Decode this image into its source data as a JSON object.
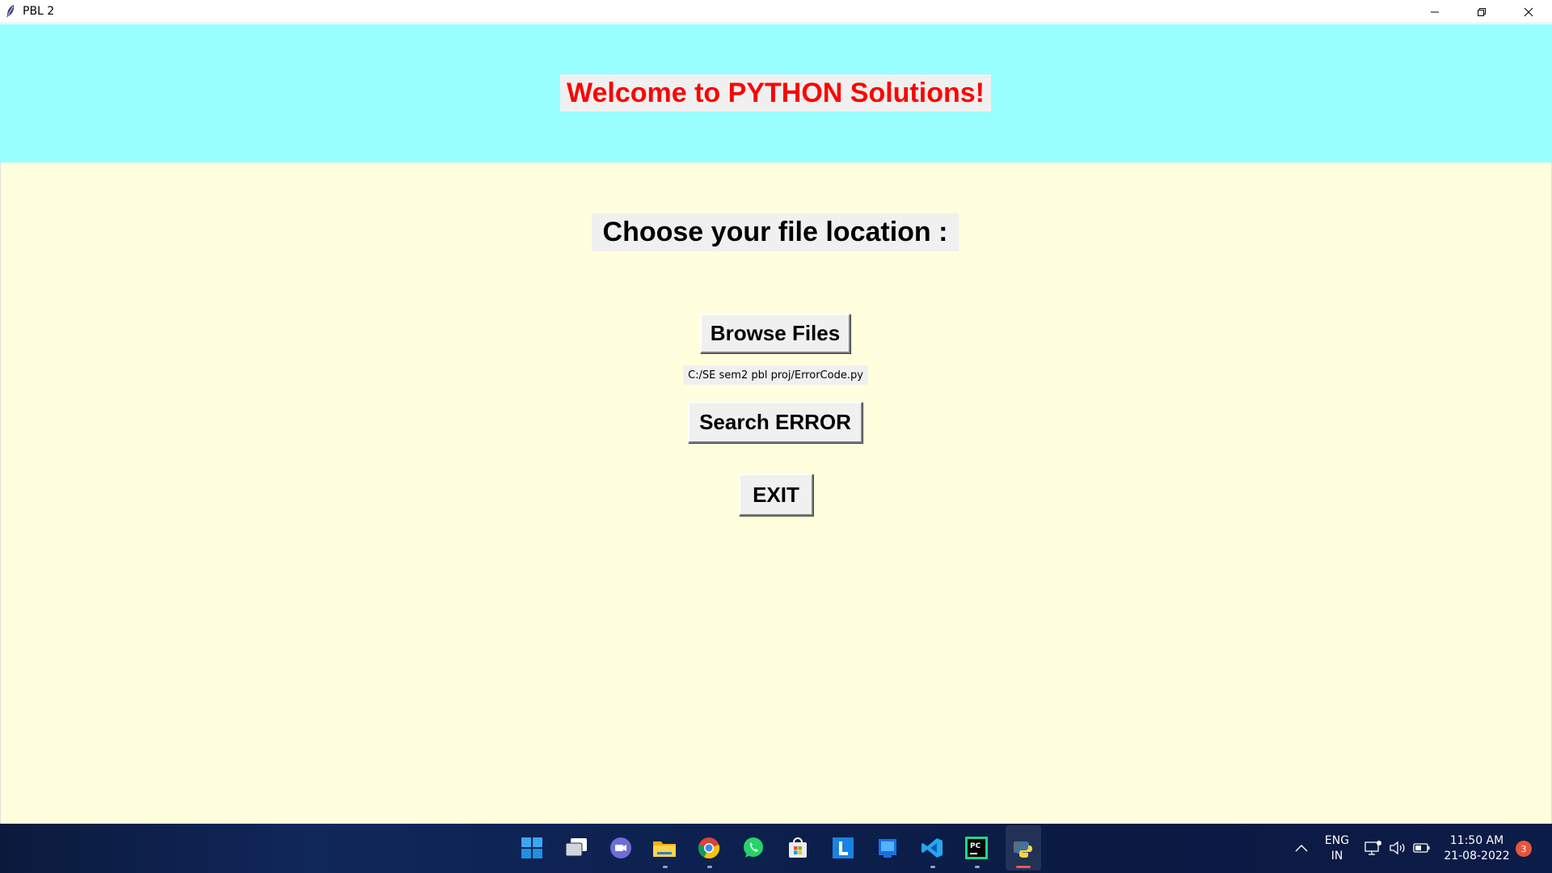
{
  "window": {
    "title": "PBL 2"
  },
  "header": {
    "welcome_text": "Welcome to PYTHON Solutions!",
    "background_color": "#99ffff",
    "text_color": "#ff0000"
  },
  "main": {
    "background_color": "#ffffdd",
    "choose_label": "Choose your file location :",
    "browse_button_label": "Browse Files",
    "selected_path": "C:/SE sem2 pbl proj/ErrorCode.py",
    "search_button_label": "Search ERROR",
    "exit_button_label": "EXIT"
  },
  "taskbar": {
    "apps": [
      {
        "name": "start-icon"
      },
      {
        "name": "task-view-icon"
      },
      {
        "name": "teams-chat-icon"
      },
      {
        "name": "file-explorer-icon"
      },
      {
        "name": "chrome-icon"
      },
      {
        "name": "whatsapp-icon"
      },
      {
        "name": "microsoft-store-icon"
      },
      {
        "name": "l-app-icon"
      },
      {
        "name": "blue-app-icon"
      },
      {
        "name": "vscode-icon"
      },
      {
        "name": "pycharm-icon"
      },
      {
        "name": "python-icon"
      }
    ],
    "language_line1": "ENG",
    "language_line2": "IN",
    "time": "11:50 AM",
    "date": "21-08-2022",
    "notification_count": "3"
  }
}
